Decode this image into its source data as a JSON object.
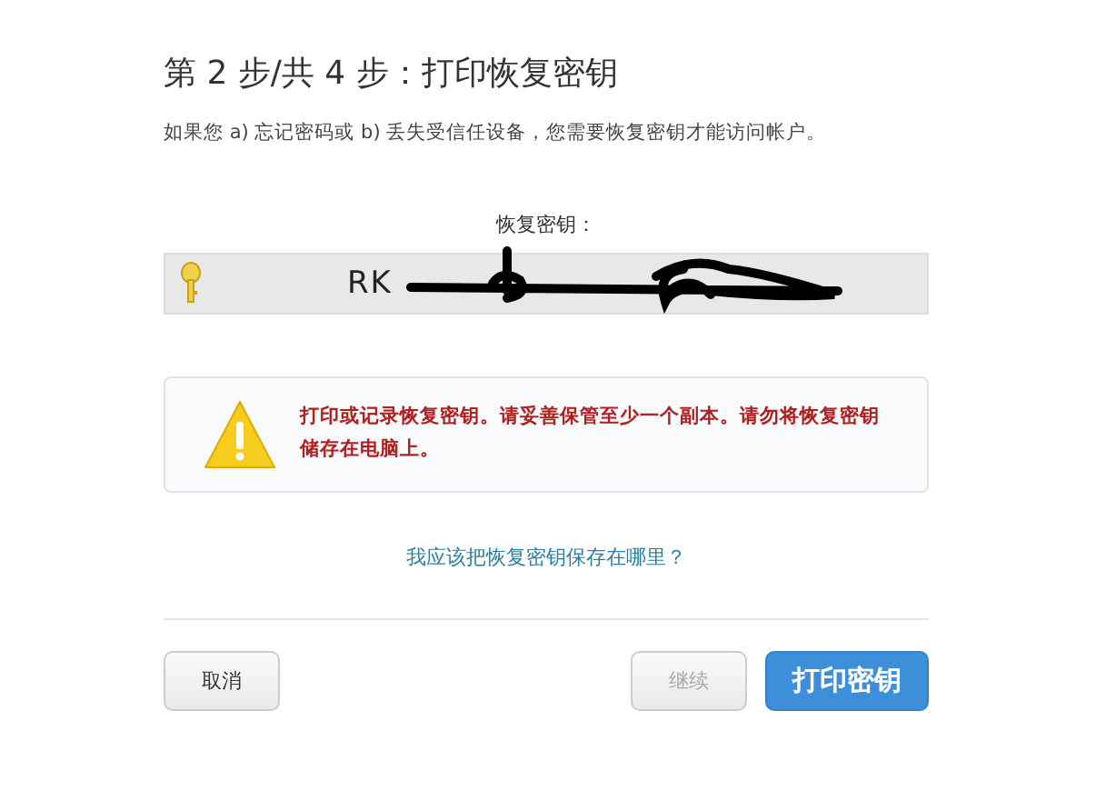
{
  "title": "第 2 步/共 4 步：打印恢复密钥",
  "description": "如果您 a) 忘记密码或 b) 丢失受信任设备，您需要恢复密钥才能访问帐户。",
  "recovery_key": {
    "label": "恢复密钥：",
    "value": "RK",
    "redacted": true
  },
  "warning": {
    "text": "打印或记录恢复密钥。请妥善保管至少一个副本。请勿将恢复密钥储存在电脑上。"
  },
  "help_link": "我应该把恢复密钥保存在哪里？",
  "buttons": [
    {
      "label": "取消",
      "kind": "secondary",
      "disabled": false
    },
    {
      "label": "继续",
      "kind": "secondary",
      "disabled": true
    },
    {
      "label": "打印密钥",
      "kind": "primary",
      "disabled": false
    }
  ]
}
